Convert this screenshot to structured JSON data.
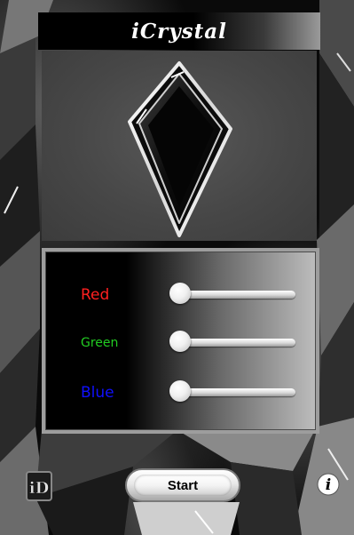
{
  "app": {
    "title": "iCrystal"
  },
  "preview": {
    "crystal_icon": "diamond-crystal-icon"
  },
  "controls": {
    "sliders": [
      {
        "label": "Red",
        "color": "#ff2020",
        "value": 0
      },
      {
        "label": "Green",
        "color": "#22cc22",
        "value": 0
      },
      {
        "label": "Blue",
        "color": "#1010ff",
        "value": 0
      }
    ]
  },
  "toolbar": {
    "left_icon": "logo-badge-icon",
    "start_label": "Start",
    "info_icon": "info-icon"
  }
}
